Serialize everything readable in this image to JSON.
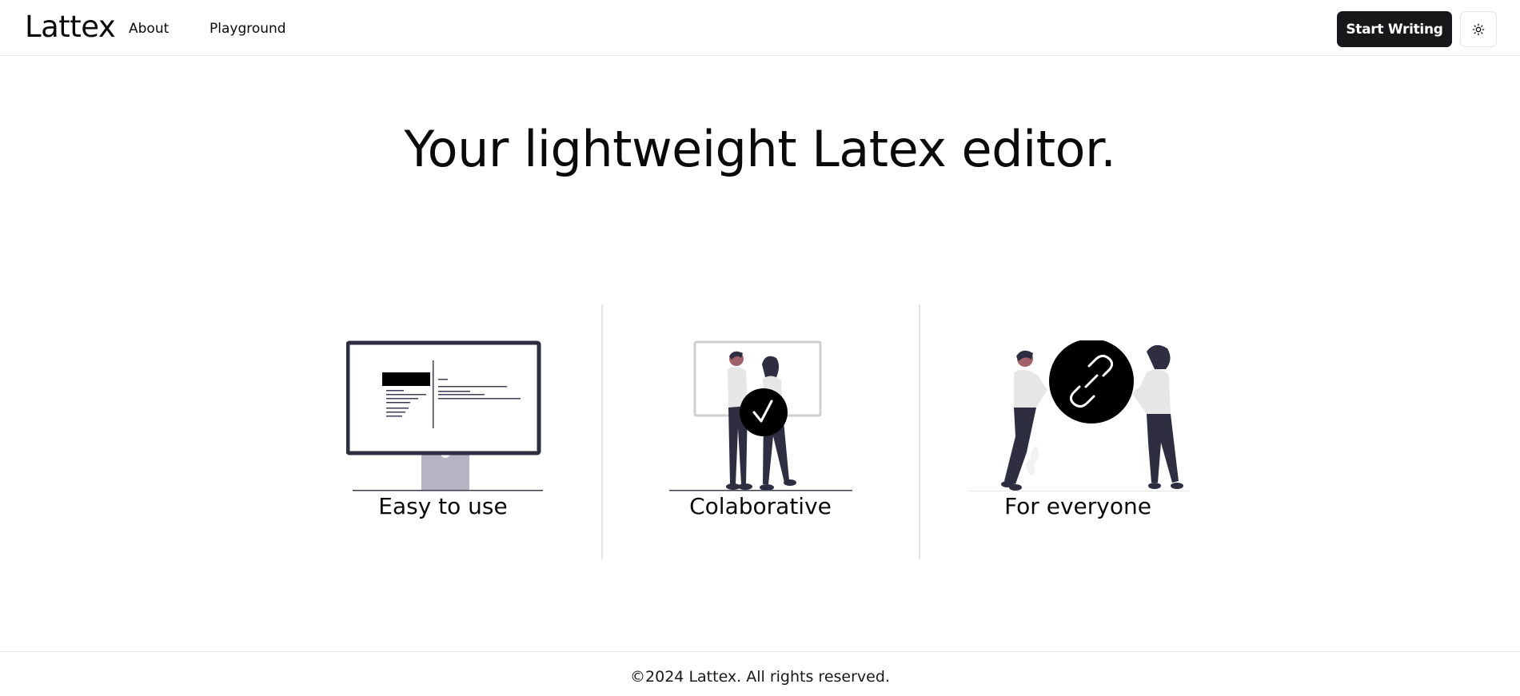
{
  "header": {
    "brand": "Lattex",
    "nav": {
      "about": "About",
      "playground": "Playground"
    },
    "cta_label": "Start Writing",
    "theme_toggle_icon": "sun-icon"
  },
  "hero": {
    "title": "Your lightweight Latex editor."
  },
  "features": [
    {
      "label": "Easy to use",
      "icon": "monitor-illustration"
    },
    {
      "label": "Colaborative",
      "icon": "people-checkmark-illustration"
    },
    {
      "label": "For everyone",
      "icon": "people-link-illustration"
    }
  ],
  "footer": {
    "text": "©2024 Lattex. All rights reserved."
  },
  "colors": {
    "text": "#0a0a0a",
    "cta_background": "#18181b",
    "cta_text": "#ffffff",
    "border": "#e4e4e7",
    "illustration_dark": "#2f2e41",
    "illustration_light": "#b6b3c5"
  }
}
